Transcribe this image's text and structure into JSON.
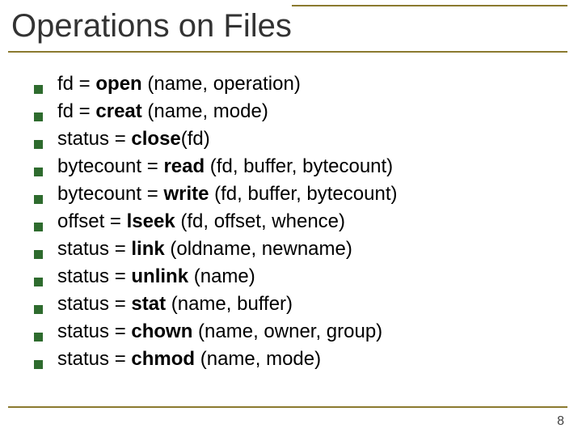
{
  "title": "Operations on Files",
  "items": [
    {
      "lhs": "fd = ",
      "fn": "open",
      "args": " (name, operation)"
    },
    {
      "lhs": "fd = ",
      "fn": "creat",
      "args": " (name, mode)"
    },
    {
      "lhs": "status = ",
      "fn": "close",
      "args": "(fd)"
    },
    {
      "lhs": "bytecount = ",
      "fn": "read",
      "args": " (fd, buffer, bytecount)"
    },
    {
      "lhs": "bytecount  = ",
      "fn": "write",
      "args": " (fd, buffer, bytecount)"
    },
    {
      "lhs": "offset = ",
      "fn": "lseek",
      "args": " (fd, offset, whence)"
    },
    {
      "lhs": "status = ",
      "fn": "link",
      "args": " (oldname, newname)"
    },
    {
      "lhs": "status = ",
      "fn": "unlink",
      "args": " (name)"
    },
    {
      "lhs": "status = ",
      "fn": "stat",
      "args": " (name, buffer)"
    },
    {
      "lhs": "status = ",
      "fn": "chown",
      "args": " (name, owner, group)"
    },
    {
      "lhs": "status = ",
      "fn": "chmod",
      "args": " (name, mode)"
    }
  ],
  "page_number": "8"
}
